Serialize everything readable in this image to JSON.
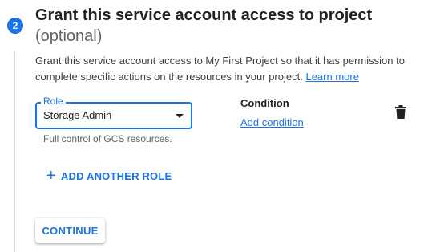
{
  "step": {
    "number": "2",
    "title": "Grant this service account access to project",
    "subtitle": "(optional)"
  },
  "description": {
    "text": "Grant this service account access to My First Project so that it has permission to complete specific actions on the resources in your project.",
    "link": "Learn more"
  },
  "role_field": {
    "label": "Role",
    "value": "Storage Admin",
    "helper": "Full control of GCS resources."
  },
  "condition": {
    "title": "Condition",
    "link": "Add condition"
  },
  "actions": {
    "add_role": "ADD ANOTHER ROLE",
    "continue": "CONTINUE"
  },
  "colors": {
    "accent": "#1a73e8",
    "text": "#202124",
    "muted": "#5f6368"
  },
  "icons": [
    "chevron-down-icon",
    "trash-icon",
    "plus-icon"
  ]
}
